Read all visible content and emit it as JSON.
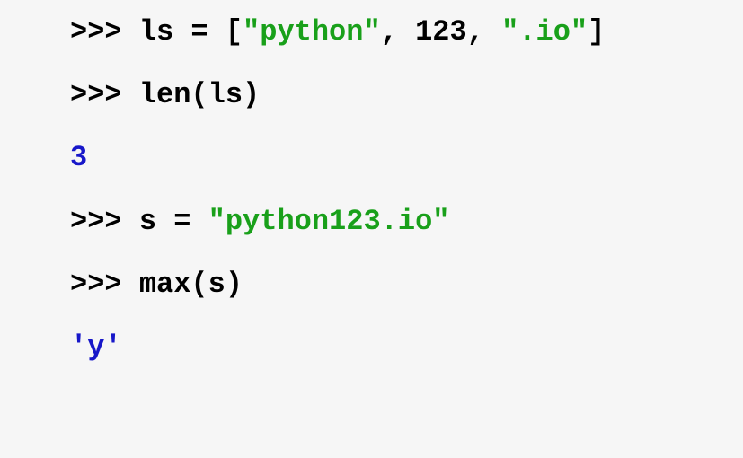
{
  "lines": {
    "l1": {
      "prompt": ">>> ",
      "var": "ls",
      "assign": " = ",
      "bracket_open": "[",
      "str1": "\"python\"",
      "comma1": ", ",
      "num1": "123",
      "comma2": ", ",
      "str2": "\".io\"",
      "bracket_close": "]"
    },
    "l2": {
      "prompt": ">>> ",
      "func": "len",
      "paren_open": "(",
      "arg": "ls",
      "paren_close": ")"
    },
    "l3": {
      "output": "3"
    },
    "l4": {
      "prompt": ">>> ",
      "var": "s",
      "assign": " = ",
      "str1": "\"python123.io\""
    },
    "l5": {
      "prompt": ">>> ",
      "func": "max",
      "paren_open": "(",
      "arg": "s",
      "paren_close": ")"
    },
    "l6": {
      "output": "'y'"
    }
  }
}
